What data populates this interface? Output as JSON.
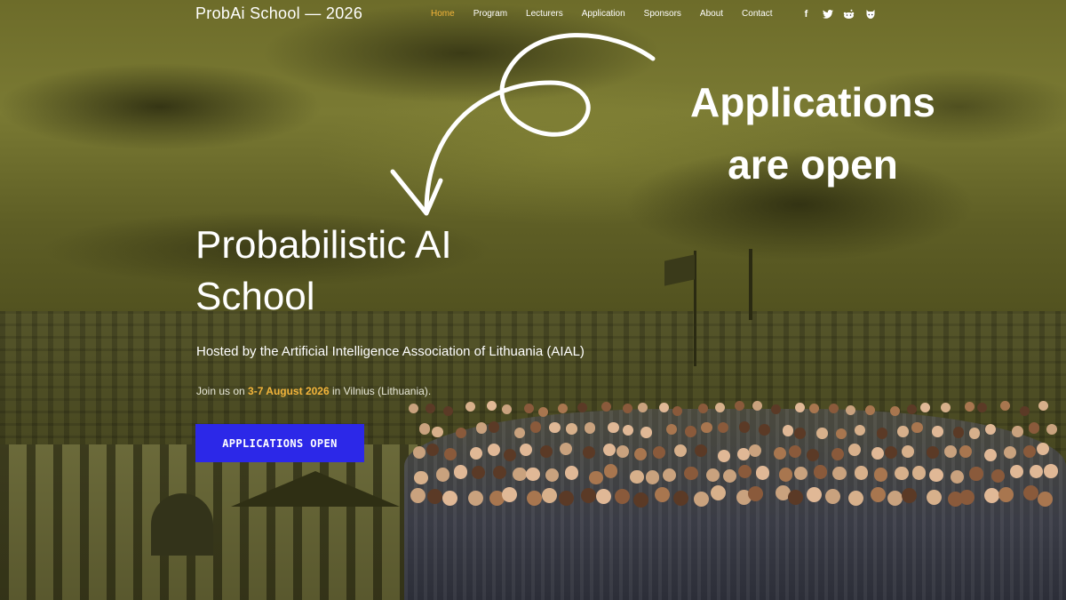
{
  "brand": {
    "name": "ProbAi School",
    "separator": "—",
    "year": "2026"
  },
  "nav": {
    "items": [
      {
        "label": "Home",
        "active": true
      },
      {
        "label": "Program",
        "active": false
      },
      {
        "label": "Lecturers",
        "active": false
      },
      {
        "label": "Application",
        "active": false
      },
      {
        "label": "Sponsors",
        "active": false
      },
      {
        "label": "About",
        "active": false
      },
      {
        "label": "Contact",
        "active": false
      }
    ],
    "social": [
      {
        "icon": "facebook-icon",
        "glyph": "f"
      },
      {
        "icon": "twitter-icon",
        "glyph": "🐦"
      },
      {
        "icon": "reddit-icon",
        "glyph": "◉"
      },
      {
        "icon": "github-icon",
        "glyph": "◆"
      }
    ]
  },
  "callout": {
    "line1": "Applications",
    "line2": "are open"
  },
  "hero": {
    "title_line1": "Probabilistic AI",
    "title_line2": "School",
    "hosted": "Hosted by the Artificial Intelligence Association of Lithuania (AIAL)",
    "join_prefix": "Join us on ",
    "join_dates": "3-7 August 2026",
    "join_suffix": " in Vilnius (Lithuania).",
    "cta_label": "APPLICATIONS OPEN"
  },
  "colors": {
    "accent": "#f3b43a",
    "cta_bg": "#2c28e8",
    "overlay_tint": "#6d6c2a"
  }
}
